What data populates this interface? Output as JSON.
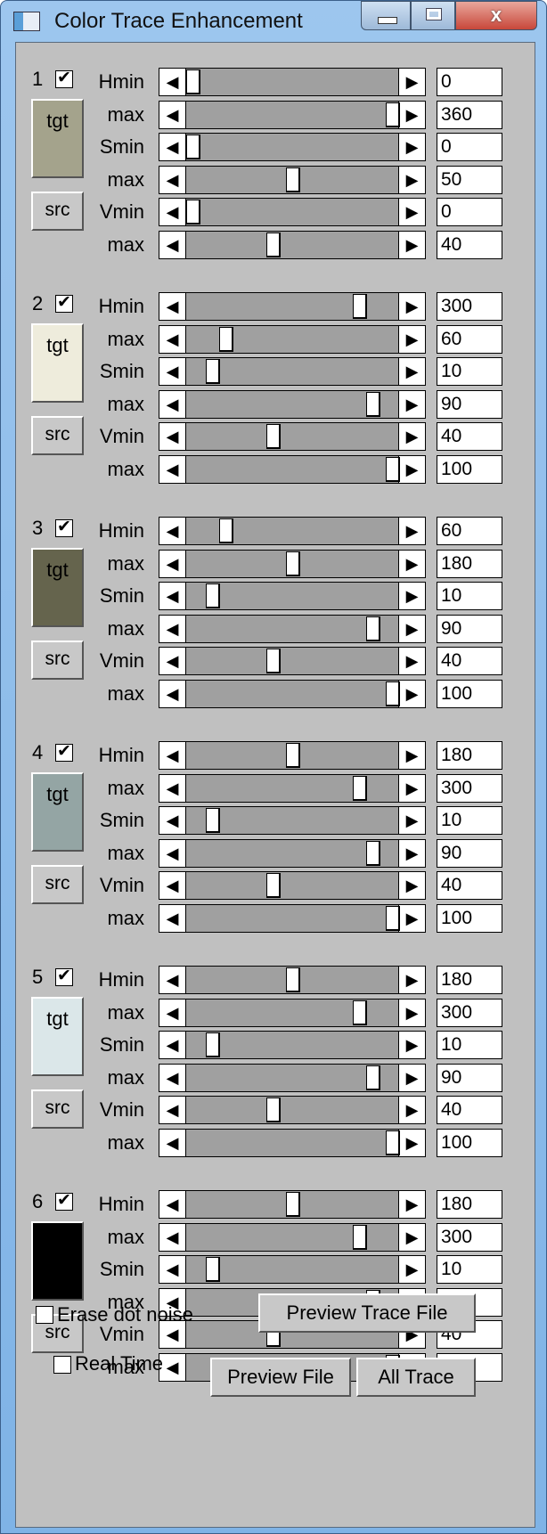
{
  "window": {
    "title": "Color Trace Enhancement",
    "controls": {
      "minimize": "minimize",
      "maximize": "maximize",
      "close": "x"
    }
  },
  "groups": [
    {
      "number": "1",
      "enabled": true,
      "tgt_label": "tgt",
      "tgt_color": "#a4a38c",
      "src_label": "src",
      "params": [
        {
          "label": "Hmin",
          "value": "0",
          "position": 0.0
        },
        {
          "label": "max",
          "value": "360",
          "position": 1.0
        },
        {
          "label": "Smin",
          "value": "0",
          "position": 0.0
        },
        {
          "label": "max",
          "value": "50",
          "position": 0.5
        },
        {
          "label": "Vmin",
          "value": "0",
          "position": 0.0
        },
        {
          "label": "max",
          "value": "40",
          "position": 0.4
        }
      ]
    },
    {
      "number": "2",
      "enabled": true,
      "tgt_label": "tgt",
      "tgt_color": "#eeecdc",
      "src_label": "src",
      "params": [
        {
          "label": "Hmin",
          "value": "300",
          "position": 0.8333
        },
        {
          "label": "max",
          "value": "60",
          "position": 0.1667
        },
        {
          "label": "Smin",
          "value": "10",
          "position": 0.1
        },
        {
          "label": "max",
          "value": "90",
          "position": 0.9
        },
        {
          "label": "Vmin",
          "value": "40",
          "position": 0.4
        },
        {
          "label": "max",
          "value": "100",
          "position": 1.0
        }
      ]
    },
    {
      "number": "3",
      "enabled": true,
      "tgt_label": "tgt",
      "tgt_color": "#65644d",
      "src_label": "src",
      "params": [
        {
          "label": "Hmin",
          "value": "60",
          "position": 0.1667
        },
        {
          "label": "max",
          "value": "180",
          "position": 0.5
        },
        {
          "label": "Smin",
          "value": "10",
          "position": 0.1
        },
        {
          "label": "max",
          "value": "90",
          "position": 0.9
        },
        {
          "label": "Vmin",
          "value": "40",
          "position": 0.4
        },
        {
          "label": "max",
          "value": "100",
          "position": 1.0
        }
      ]
    },
    {
      "number": "4",
      "enabled": true,
      "tgt_label": "tgt",
      "tgt_color": "#94a5a4",
      "src_label": "src",
      "params": [
        {
          "label": "Hmin",
          "value": "180",
          "position": 0.5
        },
        {
          "label": "max",
          "value": "300",
          "position": 0.8333
        },
        {
          "label": "Smin",
          "value": "10",
          "position": 0.1
        },
        {
          "label": "max",
          "value": "90",
          "position": 0.9
        },
        {
          "label": "Vmin",
          "value": "40",
          "position": 0.4
        },
        {
          "label": "max",
          "value": "100",
          "position": 1.0
        }
      ]
    },
    {
      "number": "5",
      "enabled": true,
      "tgt_label": "tgt",
      "tgt_color": "#dbe7e9",
      "src_label": "src",
      "params": [
        {
          "label": "Hmin",
          "value": "180",
          "position": 0.5
        },
        {
          "label": "max",
          "value": "300",
          "position": 0.8333
        },
        {
          "label": "Smin",
          "value": "10",
          "position": 0.1
        },
        {
          "label": "max",
          "value": "90",
          "position": 0.9
        },
        {
          "label": "Vmin",
          "value": "40",
          "position": 0.4
        },
        {
          "label": "max",
          "value": "100",
          "position": 1.0
        }
      ]
    },
    {
      "number": "6",
      "enabled": true,
      "tgt_label": "",
      "tgt_color": "#000000",
      "src_label": "src",
      "params": [
        {
          "label": "Hmin",
          "value": "180",
          "position": 0.5
        },
        {
          "label": "max",
          "value": "300",
          "position": 0.8333
        },
        {
          "label": "Smin",
          "value": "10",
          "position": 0.1
        },
        {
          "label": "max",
          "value": "90",
          "position": 0.9
        },
        {
          "label": "Vmin",
          "value": "40",
          "position": 0.4
        },
        {
          "label": "max",
          "value": "100",
          "position": 1.0
        }
      ]
    }
  ],
  "options": {
    "erase_dot_noise": {
      "label": "Erase dot noise",
      "checked": false
    },
    "real_time": {
      "label": "Real Time",
      "checked": false
    }
  },
  "buttons": {
    "preview_trace_file": "Preview Trace File",
    "preview_file": "Preview File",
    "all_trace": "All Trace"
  },
  "icons": {
    "scroll_left": "◀",
    "scroll_right": "▶"
  }
}
